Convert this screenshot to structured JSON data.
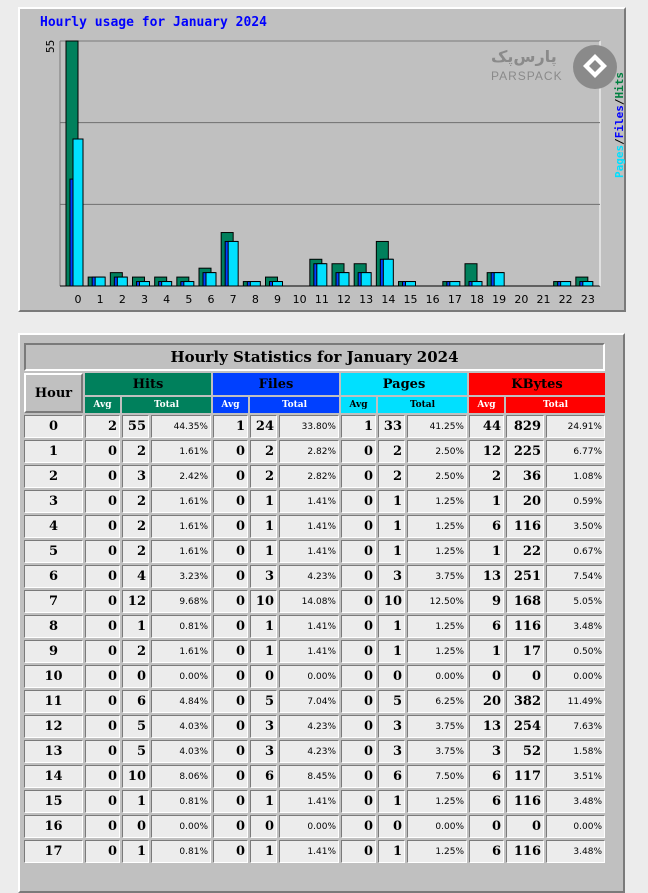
{
  "chart": {
    "title": "Hourly usage for January 2024",
    "y_max_label": "55",
    "logo_fa": "پارس‌پک",
    "logo_en": "PARSPACK",
    "legend": {
      "pages": "Pages",
      "files": "Files",
      "hits": "Hits",
      "sep": "/"
    },
    "colors": {
      "hits": "#00805c",
      "files": "#0040ff",
      "pages": "#00e0ff"
    }
  },
  "chart_data": {
    "type": "bar",
    "categories": [
      "0",
      "1",
      "2",
      "3",
      "4",
      "5",
      "6",
      "7",
      "8",
      "9",
      "10",
      "11",
      "12",
      "13",
      "14",
      "15",
      "16",
      "17",
      "18",
      "19",
      "20",
      "21",
      "22",
      "23"
    ],
    "series": [
      {
        "name": "Hits",
        "values": [
          55,
          2,
          3,
          2,
          2,
          2,
          4,
          12,
          1,
          2,
          0,
          6,
          5,
          5,
          10,
          1,
          0,
          1,
          5,
          3,
          0,
          0,
          1,
          2
        ]
      },
      {
        "name": "Files",
        "values": [
          24,
          2,
          2,
          1,
          1,
          1,
          3,
          10,
          1,
          1,
          0,
          5,
          3,
          3,
          6,
          1,
          0,
          1,
          1,
          3,
          0,
          0,
          1,
          1
        ]
      },
      {
        "name": "Pages",
        "values": [
          33,
          2,
          2,
          1,
          1,
          1,
          3,
          10,
          1,
          1,
          0,
          5,
          3,
          3,
          6,
          1,
          0,
          1,
          1,
          3,
          0,
          0,
          1,
          1
        ]
      }
    ],
    "ylim": [
      0,
      55
    ]
  },
  "table": {
    "title": "Hourly Statistics for January 2024",
    "hour_label": "Hour",
    "groups": {
      "hits": "Hits",
      "files": "Files",
      "pages": "Pages",
      "kbytes": "KBytes"
    },
    "avg_label": "Avg",
    "total_label": "Total",
    "rows": [
      {
        "hour": "0",
        "hits_avg": "2",
        "hits_total": "55",
        "hits_pct": "44.35%",
        "files_avg": "1",
        "files_total": "24",
        "files_pct": "33.80%",
        "pages_avg": "1",
        "pages_total": "33",
        "pages_pct": "41.25%",
        "kb_avg": "44",
        "kb_total": "829",
        "kb_pct": "24.91%"
      },
      {
        "hour": "1",
        "hits_avg": "0",
        "hits_total": "2",
        "hits_pct": "1.61%",
        "files_avg": "0",
        "files_total": "2",
        "files_pct": "2.82%",
        "pages_avg": "0",
        "pages_total": "2",
        "pages_pct": "2.50%",
        "kb_avg": "12",
        "kb_total": "225",
        "kb_pct": "6.77%"
      },
      {
        "hour": "2",
        "hits_avg": "0",
        "hits_total": "3",
        "hits_pct": "2.42%",
        "files_avg": "0",
        "files_total": "2",
        "files_pct": "2.82%",
        "pages_avg": "0",
        "pages_total": "2",
        "pages_pct": "2.50%",
        "kb_avg": "2",
        "kb_total": "36",
        "kb_pct": "1.08%"
      },
      {
        "hour": "3",
        "hits_avg": "0",
        "hits_total": "2",
        "hits_pct": "1.61%",
        "files_avg": "0",
        "files_total": "1",
        "files_pct": "1.41%",
        "pages_avg": "0",
        "pages_total": "1",
        "pages_pct": "1.25%",
        "kb_avg": "1",
        "kb_total": "20",
        "kb_pct": "0.59%"
      },
      {
        "hour": "4",
        "hits_avg": "0",
        "hits_total": "2",
        "hits_pct": "1.61%",
        "files_avg": "0",
        "files_total": "1",
        "files_pct": "1.41%",
        "pages_avg": "0",
        "pages_total": "1",
        "pages_pct": "1.25%",
        "kb_avg": "6",
        "kb_total": "116",
        "kb_pct": "3.50%"
      },
      {
        "hour": "5",
        "hits_avg": "0",
        "hits_total": "2",
        "hits_pct": "1.61%",
        "files_avg": "0",
        "files_total": "1",
        "files_pct": "1.41%",
        "pages_avg": "0",
        "pages_total": "1",
        "pages_pct": "1.25%",
        "kb_avg": "1",
        "kb_total": "22",
        "kb_pct": "0.67%"
      },
      {
        "hour": "6",
        "hits_avg": "0",
        "hits_total": "4",
        "hits_pct": "3.23%",
        "files_avg": "0",
        "files_total": "3",
        "files_pct": "4.23%",
        "pages_avg": "0",
        "pages_total": "3",
        "pages_pct": "3.75%",
        "kb_avg": "13",
        "kb_total": "251",
        "kb_pct": "7.54%"
      },
      {
        "hour": "7",
        "hits_avg": "0",
        "hits_total": "12",
        "hits_pct": "9.68%",
        "files_avg": "0",
        "files_total": "10",
        "files_pct": "14.08%",
        "pages_avg": "0",
        "pages_total": "10",
        "pages_pct": "12.50%",
        "kb_avg": "9",
        "kb_total": "168",
        "kb_pct": "5.05%"
      },
      {
        "hour": "8",
        "hits_avg": "0",
        "hits_total": "1",
        "hits_pct": "0.81%",
        "files_avg": "0",
        "files_total": "1",
        "files_pct": "1.41%",
        "pages_avg": "0",
        "pages_total": "1",
        "pages_pct": "1.25%",
        "kb_avg": "6",
        "kb_total": "116",
        "kb_pct": "3.48%"
      },
      {
        "hour": "9",
        "hits_avg": "0",
        "hits_total": "2",
        "hits_pct": "1.61%",
        "files_avg": "0",
        "files_total": "1",
        "files_pct": "1.41%",
        "pages_avg": "0",
        "pages_total": "1",
        "pages_pct": "1.25%",
        "kb_avg": "1",
        "kb_total": "17",
        "kb_pct": "0.50%"
      },
      {
        "hour": "10",
        "hits_avg": "0",
        "hits_total": "0",
        "hits_pct": "0.00%",
        "files_avg": "0",
        "files_total": "0",
        "files_pct": "0.00%",
        "pages_avg": "0",
        "pages_total": "0",
        "pages_pct": "0.00%",
        "kb_avg": "0",
        "kb_total": "0",
        "kb_pct": "0.00%"
      },
      {
        "hour": "11",
        "hits_avg": "0",
        "hits_total": "6",
        "hits_pct": "4.84%",
        "files_avg": "0",
        "files_total": "5",
        "files_pct": "7.04%",
        "pages_avg": "0",
        "pages_total": "5",
        "pages_pct": "6.25%",
        "kb_avg": "20",
        "kb_total": "382",
        "kb_pct": "11.49%"
      },
      {
        "hour": "12",
        "hits_avg": "0",
        "hits_total": "5",
        "hits_pct": "4.03%",
        "files_avg": "0",
        "files_total": "3",
        "files_pct": "4.23%",
        "pages_avg": "0",
        "pages_total": "3",
        "pages_pct": "3.75%",
        "kb_avg": "13",
        "kb_total": "254",
        "kb_pct": "7.63%"
      },
      {
        "hour": "13",
        "hits_avg": "0",
        "hits_total": "5",
        "hits_pct": "4.03%",
        "files_avg": "0",
        "files_total": "3",
        "files_pct": "4.23%",
        "pages_avg": "0",
        "pages_total": "3",
        "pages_pct": "3.75%",
        "kb_avg": "3",
        "kb_total": "52",
        "kb_pct": "1.58%"
      },
      {
        "hour": "14",
        "hits_avg": "0",
        "hits_total": "10",
        "hits_pct": "8.06%",
        "files_avg": "0",
        "files_total": "6",
        "files_pct": "8.45%",
        "pages_avg": "0",
        "pages_total": "6",
        "pages_pct": "7.50%",
        "kb_avg": "6",
        "kb_total": "117",
        "kb_pct": "3.51%"
      },
      {
        "hour": "15",
        "hits_avg": "0",
        "hits_total": "1",
        "hits_pct": "0.81%",
        "files_avg": "0",
        "files_total": "1",
        "files_pct": "1.41%",
        "pages_avg": "0",
        "pages_total": "1",
        "pages_pct": "1.25%",
        "kb_avg": "6",
        "kb_total": "116",
        "kb_pct": "3.48%"
      },
      {
        "hour": "16",
        "hits_avg": "0",
        "hits_total": "0",
        "hits_pct": "0.00%",
        "files_avg": "0",
        "files_total": "0",
        "files_pct": "0.00%",
        "pages_avg": "0",
        "pages_total": "0",
        "pages_pct": "0.00%",
        "kb_avg": "0",
        "kb_total": "0",
        "kb_pct": "0.00%"
      },
      {
        "hour": "17",
        "hits_avg": "0",
        "hits_total": "1",
        "hits_pct": "0.81%",
        "files_avg": "0",
        "files_total": "1",
        "files_pct": "1.41%",
        "pages_avg": "0",
        "pages_total": "1",
        "pages_pct": "1.25%",
        "kb_avg": "6",
        "kb_total": "116",
        "kb_pct": "3.48%"
      }
    ]
  }
}
